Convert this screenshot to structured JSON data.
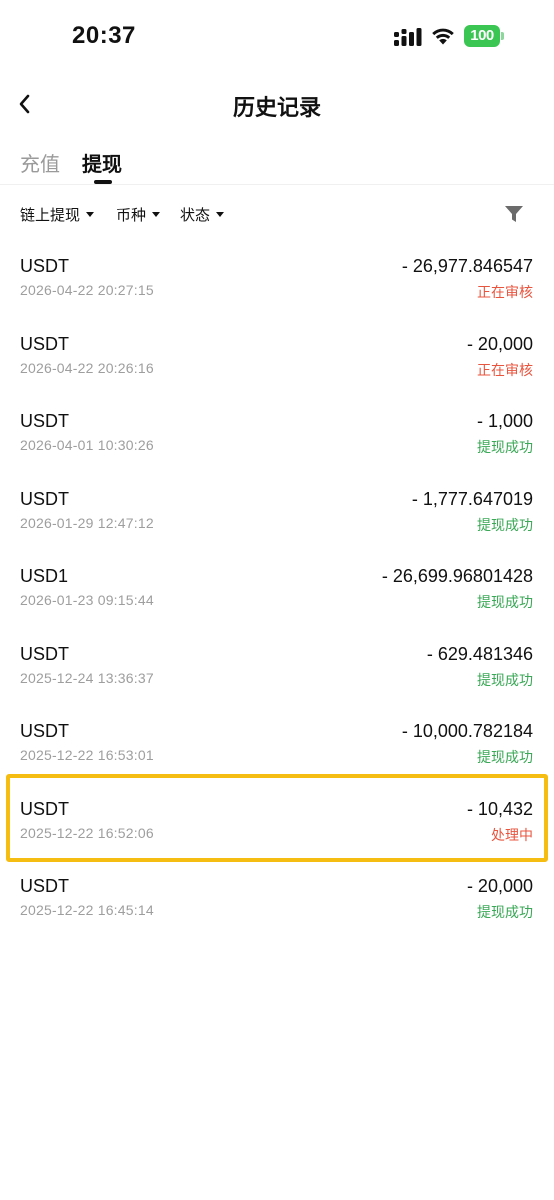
{
  "status_bar": {
    "time": "20:37",
    "battery": "100",
    "icons": [
      "signal-icon",
      "wifi-icon",
      "battery-icon"
    ],
    "battery_color": "#3bc552"
  },
  "header": {
    "title": "历史记录",
    "back_icon": "chevron-left-icon"
  },
  "tabs": [
    {
      "label": "充值",
      "active": false
    },
    {
      "label": "提现",
      "active": true
    }
  ],
  "filters": [
    {
      "label": "链上提现"
    },
    {
      "label": "币种"
    },
    {
      "label": "状态"
    }
  ],
  "filter_icon": "funnel-icon",
  "records": [
    {
      "coin": "USDT",
      "time": "2026-04-22 20:27:15",
      "amount": "- 26,977.846547",
      "status": "正在审核",
      "status_type": "red"
    },
    {
      "coin": "USDT",
      "time": "2026-04-22 20:26:16",
      "amount": "- 20,000",
      "status": "正在审核",
      "status_type": "red"
    },
    {
      "coin": "USDT",
      "time": "2026-04-01 10:30:26",
      "amount": "- 1,000",
      "status": "提现成功",
      "status_type": "green"
    },
    {
      "coin": "USDT",
      "time": "2026-01-29 12:47:12",
      "amount": "- 1,777.647019",
      "status": "提现成功",
      "status_type": "green"
    },
    {
      "coin": "USD1",
      "time": "2026-01-23 09:15:44",
      "amount": "- 26,699.96801428",
      "status": "提现成功",
      "status_type": "green"
    },
    {
      "coin": "USDT",
      "time": "2025-12-24 13:36:37",
      "amount": "- 629.481346",
      "status": "提现成功",
      "status_type": "green"
    },
    {
      "coin": "USDT",
      "time": "2025-12-22 16:53:01",
      "amount": "- 10,000.782184",
      "status": "提现成功",
      "status_type": "green"
    },
    {
      "coin": "USDT",
      "time": "2025-12-22 16:52:06",
      "amount": "- 10,432",
      "status": "处理中",
      "status_type": "red",
      "highlighted": true
    },
    {
      "coin": "USDT",
      "time": "2025-12-22 16:45:14",
      "amount": "- 20,000",
      "status": "提现成功",
      "status_type": "green"
    }
  ],
  "colors": {
    "status_red": "#e8553f",
    "status_green": "#3aa856",
    "highlight": "#f5bc11"
  }
}
